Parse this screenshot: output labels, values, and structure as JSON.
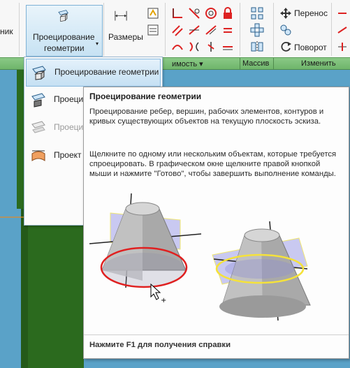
{
  "ribbon": {
    "partial_left_label": "ник",
    "project_geometry_label_line1": "Проецирование",
    "project_geometry_label_line2": "геометрии",
    "dimension_label": "Размеры",
    "move_label": "Перенос",
    "rotate_label": "Поворот",
    "panels": {
      "constrain_partial": "имость",
      "array": "Массив",
      "modify": "Изменить"
    }
  },
  "dropdown": {
    "items": [
      {
        "label": "Проецирование геометрии"
      },
      {
        "label": "Проецир"
      },
      {
        "label": "Проецир"
      },
      {
        "label": "Проект в"
      }
    ]
  },
  "tooltip": {
    "title": "Проецирование геометрии",
    "description": "Проецирование ребер, вершин, рабочих элементов, контуров и кривых существующих объектов на текущую плоскость эскиза.",
    "instructions": "Щелкните по одному или нескольким объектам, которые требуется спроецировать. В графическом окне щелкните правой кнопкой мыши и нажмите \"Готово\", чтобы завершить выполнение команды.",
    "footer": "Нажмите F1 для получения справки"
  },
  "colors": {
    "accent": "#7eb2d6",
    "canvas": "#5aa2c8",
    "model_green": "#2b6a1e",
    "ribbon_bar": "#7cbf78",
    "highlight_red": "#e02020",
    "highlight_yellow": "#f5e23a"
  }
}
